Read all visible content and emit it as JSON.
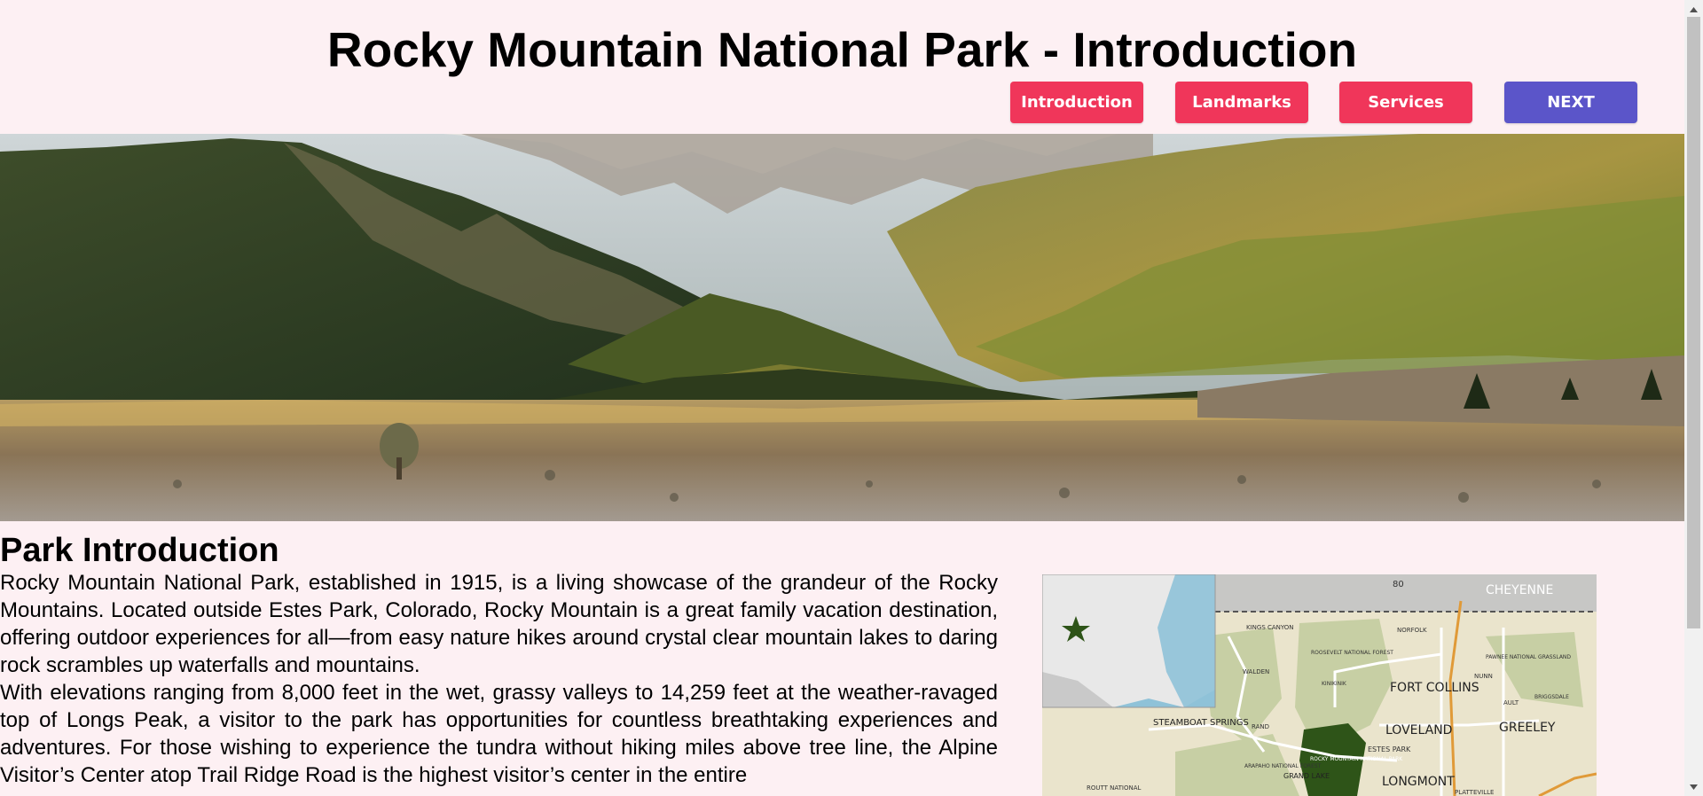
{
  "page": {
    "title": "Rocky Mountain National Park - Introduction"
  },
  "nav": {
    "items": [
      {
        "label": "Introduction",
        "color": "#f0365a"
      },
      {
        "label": "Landmarks",
        "color": "#f0365a"
      },
      {
        "label": "Services",
        "color": "#f0365a"
      },
      {
        "label": "NEXT",
        "color": "#5b55c9"
      }
    ]
  },
  "hero": {
    "icon": "mountain-valley-photo"
  },
  "content": {
    "heading": "Park Introduction",
    "paragraphs": [
      "Rocky Mountain National Park, established in 1915, is a living showcase of the grandeur of the Rocky Mountains. Located outside Estes Park, Colorado, Rocky Mountain is a great family vacation destination, offering outdoor experiences for all—from easy nature hikes around crystal clear mountain lakes to daring rock scrambles up waterfalls and mountains.",
      "With elevations ranging from 8,000 feet in the wet, grassy valleys to 14,259 feet at the weather-ravaged top of Longs Peak, a visitor to the park has opportunities for countless breathtaking experiences and adventures. For those wishing to experience the tundra without hiking miles above tree line, the Alpine Visitor’s Center atop Trail Ridge Road is the highest visitor’s center in the entire"
    ]
  },
  "map": {
    "labels": {
      "cheyenne": "CHEYENNE",
      "highway": "80",
      "kings_canyon": "KINGS CANYON",
      "roosevelt": "ROOSEVELT NATIONAL FOREST",
      "norfolk": "NORFOLK",
      "pawnee": "PAWNEE NATIONAL GRASSLAND",
      "walden": "WALDEN",
      "kinikinik": "KINIKINIK",
      "fort_collins": "FORT COLLINS",
      "nunn": "NUNN",
      "ault": "AULT",
      "briggsdale": "BRIGGSDALE",
      "steamboat": "STEAMBOAT SPRINGS",
      "rand": "RAND",
      "loveland": "LOVELAND",
      "greeley": "GREELEY",
      "estes_park": "ESTES PARK",
      "rmnp": "ROCKY MOUNTAIN NATIONAL PARK",
      "arapaho": "ARAPAHO NATIONAL FOREST",
      "grand_lake": "GRAND LAKE",
      "longmont": "LONGMONT",
      "routt": "ROUTT NATIONAL",
      "platteville": "PLATTEVILLE"
    }
  }
}
